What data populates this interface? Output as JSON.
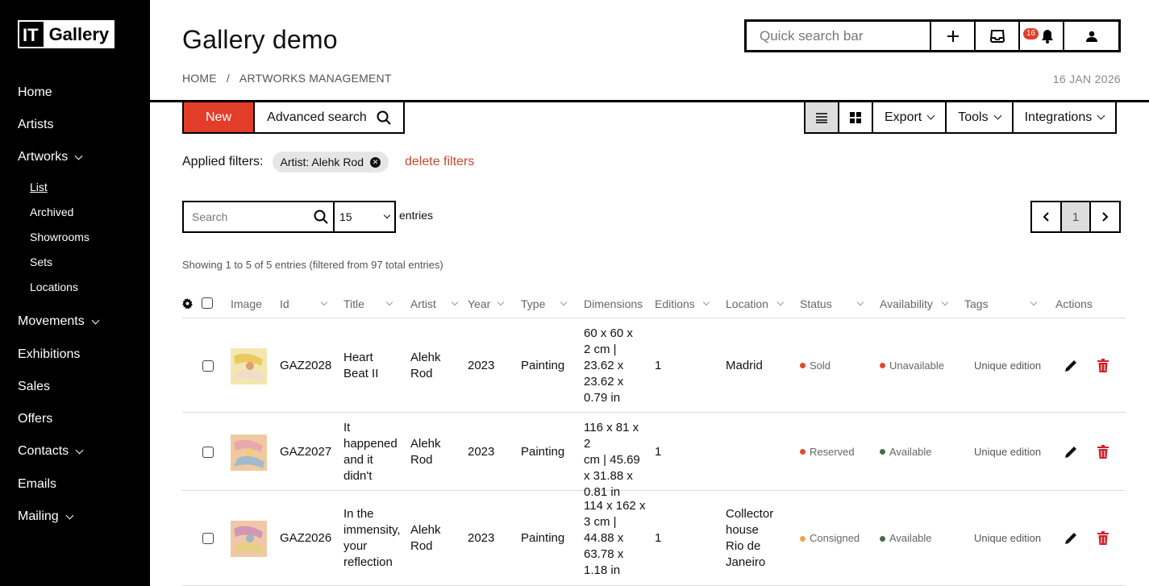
{
  "app": {
    "logo_left": "IT",
    "logo_right": "Gallery",
    "title": "Gallery demo"
  },
  "sidebar": {
    "items": [
      {
        "label": "Home"
      },
      {
        "label": "Artists"
      },
      {
        "label": "Artworks",
        "expandable": true
      },
      {
        "label": "Movements",
        "expandable": true
      },
      {
        "label": "Exhibitions"
      },
      {
        "label": "Sales"
      },
      {
        "label": "Offers"
      },
      {
        "label": "Contacts",
        "expandable": true
      },
      {
        "label": "Emails"
      },
      {
        "label": "Mailing",
        "expandable": true
      }
    ],
    "artworks_sub": [
      {
        "label": "List",
        "active": true
      },
      {
        "label": "Archived"
      },
      {
        "label": "Showrooms"
      },
      {
        "label": "Sets"
      },
      {
        "label": "Locations"
      }
    ]
  },
  "topbar": {
    "search_placeholder": "Quick search bar",
    "notifications_count": "16",
    "icons": [
      "plus-icon",
      "inbox-icon",
      "bell-icon",
      "user-icon"
    ]
  },
  "breadcrumb": {
    "home": "HOME",
    "sep": "/",
    "current": "ARTWORKS MANAGEMENT"
  },
  "date": "16 JAN 2026",
  "toolbar": {
    "new_label": "New",
    "advanced_search_label": "Advanced search",
    "export_label": "Export",
    "tools_label": "Tools",
    "integrations_label": "Integrations"
  },
  "filters": {
    "label": "Applied filters:",
    "chip_key": "Artist:",
    "chip_value": "Alehk Rod",
    "delete_label": "delete filters"
  },
  "list_controls": {
    "search_placeholder": "Search",
    "page_size": "15",
    "entries_label": "entries",
    "current_page": "1",
    "showing_text": "Showing 1 to 5 of 5 entries (filtered from 97 total entries)"
  },
  "table": {
    "headers": [
      "Image",
      "Id",
      "Title",
      "Artist",
      "Year",
      "Type",
      "Dimensions",
      "Editions",
      "Location",
      "Status",
      "Availability",
      "Tags",
      "Actions"
    ],
    "rows": [
      {
        "id": "GAZ2028",
        "title_lines": [
          "Heart",
          "Beat II"
        ],
        "artist_lines": [
          "Alehk",
          "Rod"
        ],
        "year": "2023",
        "type": "Painting",
        "dim_lines": [
          "60 x 60 x",
          "2 cm |",
          "23.62 x",
          "23.62 x",
          "0.79 in"
        ],
        "editions": "1",
        "location_lines": [
          "Madrid"
        ],
        "status": "Sold",
        "status_color": "#e24a2b",
        "availability": "Unavailable",
        "availability_color": "#e24a2b",
        "tags": "Unique edition"
      },
      {
        "id": "GAZ2027",
        "title_lines": [
          "It",
          "happened",
          "and it",
          "didn't"
        ],
        "artist_lines": [
          "Alehk",
          "Rod"
        ],
        "year": "2023",
        "type": "Painting",
        "dim_lines": [
          "116 x 81 x 2",
          "cm | 45.69",
          "x 31.88 x",
          "0.81 in"
        ],
        "editions": "1",
        "location_lines": [],
        "status": "Reserved",
        "status_color": "#e24a2b",
        "availability": "Available",
        "availability_color": "#4a6b4a",
        "tags": "Unique edition"
      },
      {
        "id": "GAZ2026",
        "title_lines": [
          "In the",
          "immensity,",
          "your",
          "reflection"
        ],
        "artist_lines": [
          "Alehk",
          "Rod"
        ],
        "year": "2023",
        "type": "Painting",
        "dim_lines": [
          "114 x 162 x",
          "3 cm |",
          "44.88 x",
          "63.78 x",
          "1.18 in"
        ],
        "editions": "1",
        "location_lines": [
          "Collector",
          "house",
          "Rio de",
          "Janeiro"
        ],
        "status": "Consigned",
        "status_color": "#e8a94a",
        "availability": "Available",
        "availability_color": "#4a6b4a",
        "tags": "Unique edition"
      }
    ]
  }
}
